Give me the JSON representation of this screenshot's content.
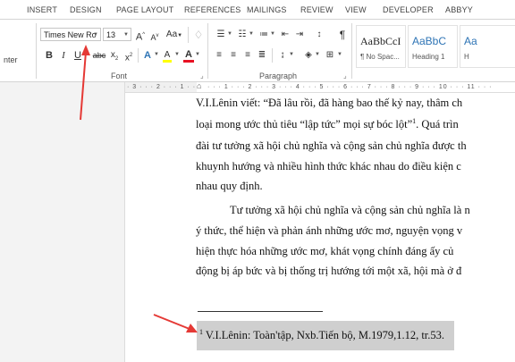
{
  "ribbon_tabs": [
    "INSERT",
    "DESIGN",
    "PAGE LAYOUT",
    "REFERENCES",
    "MAILINGS",
    "REVIEW",
    "VIEW",
    "DEVELOPER",
    "ABBYY"
  ],
  "clipboard": {
    "partial_label": "nter"
  },
  "font": {
    "name": "Times New Ro",
    "size": "13",
    "grow_label": "A",
    "shrink_label": "A",
    "case_label": "Aa",
    "bold_label": "B",
    "italic_label": "I",
    "underline_label": "U",
    "strike_label": "abc",
    "subscript_label": "x",
    "superscript_label": "x",
    "highlight_label": "A",
    "color_label": "A",
    "group_label": "Font"
  },
  "paragraph": {
    "group_label": "Paragraph",
    "pilcrow": "¶"
  },
  "styles": [
    {
      "sample": "AaBbCcI",
      "name": "¶ No Spac..."
    },
    {
      "sample": "AaBbC",
      "name": "Heading 1"
    },
    {
      "sample": "Aa",
      "name": "H"
    }
  ],
  "colors": {
    "highlight": "#ffff00",
    "font_color": "#e81123",
    "heading_blue": "#2e74b5",
    "arrow": "#e53935"
  },
  "document": {
    "paragraph1": [
      "V.I.Lênin viết: “Đã lâu rồi, đã hàng bao thế kỷ nay, thâm ch",
      "loại mong ước thủ tiêu “lập tức” mọi sự bóc lột”",
      "đài tư tưởng xã hội chủ nghĩa và cộng sản chủ nghĩa được th",
      "khuynh hướng và nhiều hình thức khác nhau do điều kiện c",
      "nhau quy định."
    ],
    "footnote_ref": "1",
    "paragraph1_tail": ". Quá trìn",
    "paragraph2": [
      "Tư tưởng xã hội chủ nghĩa và cộng sản chủ nghĩa là n",
      "ý thức, thể hiện và phản ánh những ước mơ, nguyện vọng v",
      "hiện thực hóa những ước mơ, khát vọng chính đáng ấy củ",
      "động bị áp bức và bị thống trị hướng tới một xã, hội mà ở đ"
    ],
    "footnote": {
      "marker": "1",
      "text": "V.I.Lênin: Toàn'tập, Nxb.Tiến bộ, M.1979,1.12, tr.53."
    }
  }
}
